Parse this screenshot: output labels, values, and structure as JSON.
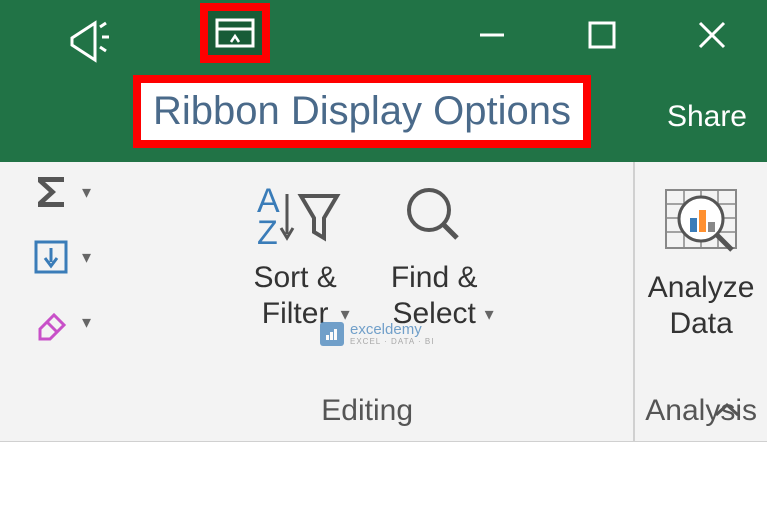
{
  "titlebar": {
    "tooltip": "Ribbon Display Options",
    "share_label": "Share"
  },
  "ribbon": {
    "editing": {
      "sort_filter": "Sort &\nFilter",
      "find_select": "Find &\nSelect",
      "group_label": "Editing"
    },
    "analysis": {
      "analyze_data": "Analyze\nData",
      "group_label": "Analysis"
    }
  },
  "watermark": {
    "brand": "exceldemy",
    "tagline": "EXCEL · DATA · BI"
  }
}
